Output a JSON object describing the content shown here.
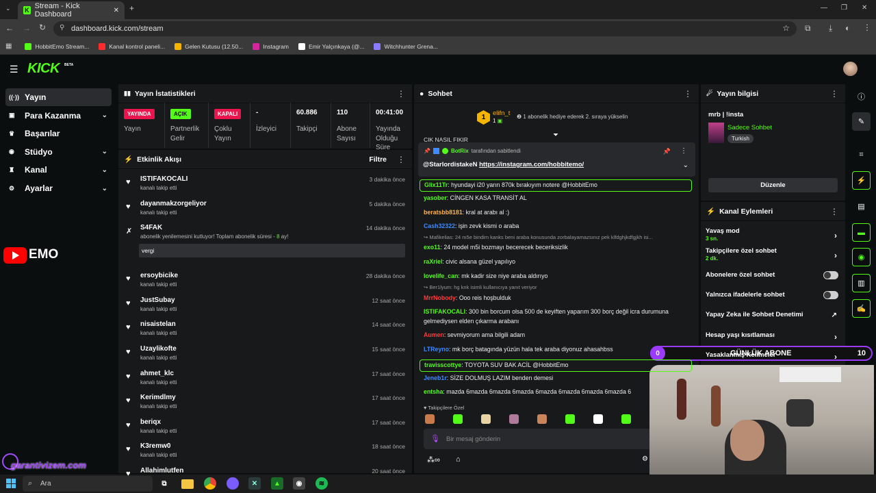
{
  "browser": {
    "tab_title": "Stream - Kick Dashboard",
    "url": "dashboard.kick.com/stream",
    "bookmarks": [
      {
        "label": "HobbitEmo Stream...",
        "color": "#53fc18"
      },
      {
        "label": "Kanal kontrol paneli...",
        "color": "#ff2a2a"
      },
      {
        "label": "Gelen Kutusu (12.50...",
        "color": "#f4b400"
      },
      {
        "label": "Instagram",
        "color": "#d6249f"
      },
      {
        "label": "Emir Yalçınkaya (@...",
        "color": "#ffffff"
      },
      {
        "label": "Witchhunter Grena...",
        "color": "#8a7cff"
      }
    ]
  },
  "app": {
    "logo": "KICK",
    "beta": "BETA",
    "accent": "#53fc18"
  },
  "sidenav": [
    {
      "label": "Yayın",
      "icon": "broadcast-icon",
      "active": true,
      "chevron": false
    },
    {
      "label": "Para Kazanma",
      "icon": "money-icon",
      "active": false,
      "chevron": true
    },
    {
      "label": "Başarılar",
      "icon": "trophy-icon",
      "active": false,
      "chevron": false
    },
    {
      "label": "Stüdyo",
      "icon": "studio-icon",
      "active": false,
      "chevron": true
    },
    {
      "label": "Kanal",
      "icon": "channel-icon",
      "active": false,
      "chevron": true
    },
    {
      "label": "Ayarlar",
      "icon": "gear-icon",
      "active": false,
      "chevron": true
    }
  ],
  "overlay": {
    "emo_text": "EMO",
    "brand": "garantivizem.com",
    "goal_count": "0",
    "goal_label": "GÜNLÜK ABONE",
    "goal_target": "10"
  },
  "stats": {
    "title": "Yayın İstatistikleri",
    "items": [
      {
        "badge": "YAYINDA",
        "badge_color": "#e9154c",
        "label": "Yayın"
      },
      {
        "badge": "AÇIK",
        "badge_color": "#53fc18",
        "label": "Partnerlik Gelir"
      },
      {
        "badge": "KAPALI",
        "badge_color": "#e9154c",
        "label": "Çoklu Yayın"
      },
      {
        "value": "-",
        "label": "İzleyici"
      },
      {
        "value": "60.886",
        "label": "Takipçi"
      },
      {
        "value": "110",
        "label": "Abone Sayısı"
      },
      {
        "value": "00:41:00",
        "label": "Yayında Olduğu Süre"
      }
    ]
  },
  "activity": {
    "title": "Etkinlik Akışı",
    "filter": "Filtre",
    "items": [
      {
        "user": "ISTIFAKOCALI",
        "desc": "kanalı takip etti",
        "time": "3 dakika önce"
      },
      {
        "user": "dayanmakzorgeliyor",
        "desc": "kanalı takip etti",
        "time": "5 dakika önce"
      },
      {
        "user": "S4FAK",
        "desc": "abonelik yenilemesini kutluyor! Toplam abonelik süresi -",
        "months": "8",
        "months_suffix": "ay!",
        "message": "vergi",
        "time": "14 dakika önce"
      },
      {
        "user": "ersoybicike",
        "desc": "kanalı takip etti",
        "time": "28 dakika önce"
      },
      {
        "user": "JustSubay",
        "desc": "kanalı takip etti",
        "time": "12 saat önce"
      },
      {
        "user": "nisaistelan",
        "desc": "kanalı takip etti",
        "time": "14 saat önce"
      },
      {
        "user": "Uzaylikofte",
        "desc": "kanalı takip etti",
        "time": "15 saat önce"
      },
      {
        "user": "ahmet_klc",
        "desc": "kanalı takip etti",
        "time": "17 saat önce"
      },
      {
        "user": "Kerimdlmy",
        "desc": "kanalı takip etti",
        "time": "17 saat önce"
      },
      {
        "user": "beriqx",
        "desc": "kanalı takip etti",
        "time": "17 saat önce"
      },
      {
        "user": "K3remw0",
        "desc": "kanalı takip etti",
        "time": "18 saat önce"
      },
      {
        "user": "Allahimlutfen",
        "desc": "",
        "time": "20 saat önce"
      }
    ]
  },
  "chat": {
    "title": "Sohbet",
    "top_gifter": {
      "name": "elifn_t",
      "rank": "1",
      "count": "1",
      "note": "1 abonelik hediye ederek 2. sıraya yükselin"
    },
    "cut_line": "CIK NASIL FIKIR",
    "pinned": {
      "by": "BotRix",
      "by_suffix": "tarafından sabitlendi",
      "mention": "@StarlordistakeN",
      "link": "https://instagram.com/hobbitemo/"
    },
    "messages": [
      {
        "user": "Glix11Tr",
        "color": "#53fc18",
        "text": "hyundayi i20 yarın 870k bırakıyım notere @HobbitEmo",
        "highlight": true
      },
      {
        "user": "yasober",
        "color": "#53fc18",
        "text": "CİNGEN KASA TRANSİT AL"
      },
      {
        "user": "beratsbb8181",
        "color": "#ffb347",
        "text": "kral at arabı al :)"
      },
      {
        "user": "Cash32322",
        "color": "#3d8bff",
        "text": "işin zevk kismi o araba"
      },
      {
        "reply": "Mafikelias: 24 m5e bindim kanks beni araba konusunda zorbalayamazsınız pek klfdghjkdfgjkh isi..."
      },
      {
        "user": "exo11",
        "color": "#53fc18",
        "text": "24 model m5i bozmayı becerecek beceriksizlik"
      },
      {
        "user": "raXriel",
        "color": "#53fc18",
        "text": "civic alsana güzel yapılıyo"
      },
      {
        "user": "lovelife_can",
        "color": "#53fc18",
        "text": "mk kadir size niye araba aldırıyo"
      },
      {
        "reply": "Ber1lyum: hg knk isimli kullanıcıya yanıt veriyor"
      },
      {
        "user": "MrrNobody",
        "color": "#ff3b3b",
        "text": "Ooo reis hoşbulduk"
      },
      {
        "user": "ISTIFAKOCALI",
        "color": "#53fc18",
        "text": "300 bin borcum olsa 500 de keyiften yaparım 300 borç değil icra durumuna gelmediysen elden çıkarma arabanı"
      },
      {
        "user": "Aumen",
        "color": "#ff3b3b",
        "text": "sevmiyorum ama bilgili adam"
      },
      {
        "user": "LTReyno",
        "color": "#3d8bff",
        "text": "mk borç batagında yüzün hala tek araba diyonuz ahasahbss"
      },
      {
        "user": "travisscottye",
        "color": "#53fc18",
        "text": "TOYOTA SUV BAK ACİL @HobbitEmo",
        "highlight": true
      },
      {
        "user": "Jeneb1r",
        "color": "#3d8bff",
        "text": "SİZE DOLMUŞ LAZIM benden demesi"
      },
      {
        "user": "entsha",
        "color": "#53fc18",
        "text": "mazda 6mazda 6mazda 6mazda 6mazda 6mazda 6mazda 6mazda 6"
      }
    ],
    "followers_only": "Takipçilere Özel",
    "input_placeholder": "Bir mesaj gönderin"
  },
  "info": {
    "title": "Yayın bilgisi",
    "stream_title": "mrb | !insta",
    "category": "Sadece Sohbet",
    "language": "Turkish",
    "edit": "Düzenle"
  },
  "actions": {
    "title": "Kanal Eylemleri",
    "items": [
      {
        "label": "Yavaş mod",
        "sub": "3 sn.",
        "type": "arrow"
      },
      {
        "label": "Takipçilere özel sohbet",
        "sub": "2 dk.",
        "type": "arrow"
      },
      {
        "label": "Abonelere özel sohbet",
        "type": "toggle"
      },
      {
        "label": "Yalnızca ifadelerle sohbet",
        "type": "toggle"
      },
      {
        "label": "Yapay Zeka ile Sohbet Denetimi",
        "type": "external"
      },
      {
        "label": "Hesap yaşı kısıtlaması",
        "type": "arrow"
      },
      {
        "label": "Yasaklanmış Kelimeler",
        "type": "arrow"
      }
    ]
  },
  "taskbar": {
    "search": "Ara"
  }
}
